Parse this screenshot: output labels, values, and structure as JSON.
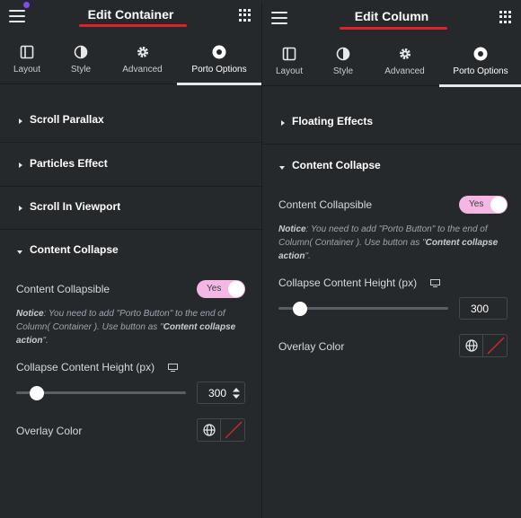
{
  "panels": {
    "container": {
      "title": "Edit Container",
      "tabs": [
        {
          "label": "Layout",
          "icon": "layout-icon"
        },
        {
          "label": "Style",
          "icon": "style-icon"
        },
        {
          "label": "Advanced",
          "icon": "gear-icon"
        },
        {
          "label": "Porto Options",
          "icon": "porto-icon",
          "active": true
        }
      ],
      "sections": [
        "Scroll Parallax",
        "Particles Effect",
        "Scroll In Viewport",
        "Content Collapse"
      ],
      "content_collapsible_label": "Content Collapsible",
      "toggle_label": "Yes",
      "notice_prefix": "Notice",
      "notice_text": ": You need to add \"Porto Button\" to the end of Column( Container ). Use button as \"",
      "notice_bold": "Content collapse action",
      "notice_suffix": "\".",
      "height_label": "Collapse Content Height (px)",
      "height_value": "300",
      "overlay_label": "Overlay Color"
    },
    "column": {
      "title": "Edit Column",
      "tabs": [
        {
          "label": "Layout",
          "icon": "layout-icon"
        },
        {
          "label": "Style",
          "icon": "style-icon"
        },
        {
          "label": "Advanced",
          "icon": "gear-icon"
        },
        {
          "label": "Porto Options",
          "icon": "porto-icon",
          "active": true
        }
      ],
      "sections": [
        "Floating Effects",
        "Content Collapse"
      ],
      "content_collapsible_label": "Content Collapsible",
      "toggle_label": "Yes",
      "notice_prefix": "Notice",
      "notice_text": ": You need to add \"Porto Button\" to the end of Column( Container ). Use button as \"",
      "notice_bold": "Content collapse action",
      "notice_suffix": "\".",
      "height_label": "Collapse Content Height (px)",
      "height_value": "300",
      "overlay_label": "Overlay Color"
    }
  },
  "colors": {
    "background": "#26292c",
    "title_underline": "#e0202d",
    "toggle_on": "#f4b6e4",
    "notification_dot": "#7a4cf5"
  }
}
